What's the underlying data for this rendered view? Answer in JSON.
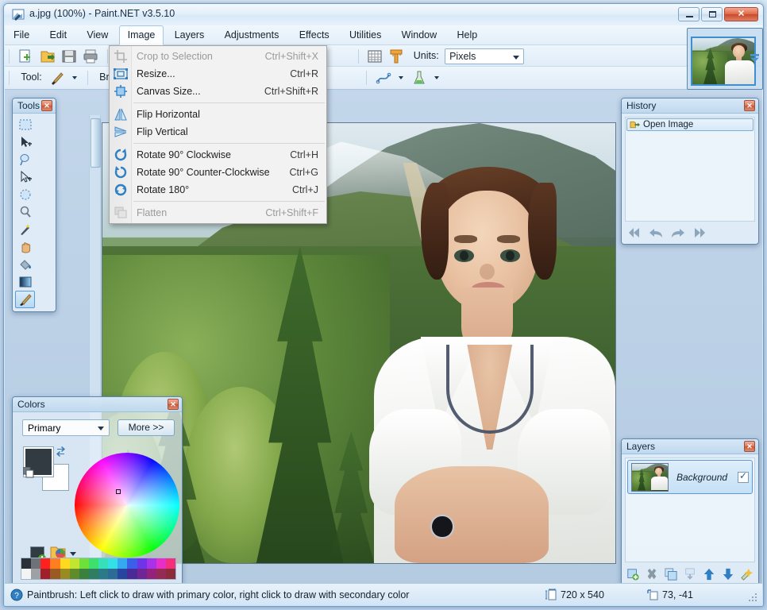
{
  "window": {
    "title": "a.jpg (100%) - Paint.NET v3.5.10",
    "icon": "paintnet-icon",
    "minimize_label": "–",
    "maximize_label": "□",
    "close_label": "✕"
  },
  "menubar": {
    "items": [
      {
        "label": "File",
        "active": false
      },
      {
        "label": "Edit",
        "active": false
      },
      {
        "label": "View",
        "active": false
      },
      {
        "label": "Image",
        "active": true
      },
      {
        "label": "Layers",
        "active": false
      },
      {
        "label": "Adjustments",
        "active": false
      },
      {
        "label": "Effects",
        "active": false
      },
      {
        "label": "Utilities",
        "active": false
      },
      {
        "label": "Window",
        "active": false
      },
      {
        "label": "Help",
        "active": false
      }
    ]
  },
  "image_menu": {
    "items": [
      {
        "label": "Crop to Selection",
        "accel": "Ctrl+Shift+X",
        "disabled": true,
        "icon": "crop-icon"
      },
      {
        "label": "Resize...",
        "accel": "Ctrl+R",
        "disabled": false,
        "icon": "resize-icon"
      },
      {
        "label": "Canvas Size...",
        "accel": "Ctrl+Shift+R",
        "disabled": false,
        "icon": "canvas-size-icon"
      },
      {
        "separator": true
      },
      {
        "label": "Flip Horizontal",
        "accel": "",
        "disabled": false,
        "icon": "flip-horizontal-icon"
      },
      {
        "label": "Flip Vertical",
        "accel": "",
        "disabled": false,
        "icon": "flip-vertical-icon"
      },
      {
        "separator": true
      },
      {
        "label": "Rotate 90° Clockwise",
        "accel": "Ctrl+H",
        "disabled": false,
        "icon": "rotate-cw-icon"
      },
      {
        "label": "Rotate 90° Counter-Clockwise",
        "accel": "Ctrl+G",
        "disabled": false,
        "icon": "rotate-ccw-icon"
      },
      {
        "label": "Rotate 180°",
        "accel": "Ctrl+J",
        "disabled": false,
        "icon": "rotate-180-icon"
      },
      {
        "separator": true
      },
      {
        "label": "Flatten",
        "accel": "Ctrl+Shift+F",
        "disabled": true,
        "icon": "flatten-icon"
      }
    ]
  },
  "toolbar": {
    "buttons": [
      "new-icon",
      "open-icon",
      "save-icon",
      "print-icon",
      "cut-icon"
    ],
    "grid_icon": "grid-icon",
    "ruler_icon": "ruler-icon",
    "units_label": "Units:",
    "units_value": "Pixels",
    "tool_label": "Tool:",
    "tool_icon": "paintbrush-icon",
    "brush_label": "Brush",
    "curve_icon": "curve-icon",
    "antialias_icon": "antialiasing-icon"
  },
  "tools_panel": {
    "title": "Tools",
    "close_label": "✕",
    "tools": [
      {
        "name": "rectangle-select-tool"
      },
      {
        "name": "move-selected-tool"
      },
      {
        "name": "lasso-select-tool"
      },
      {
        "name": "move-selection-tool"
      },
      {
        "name": "ellipse-select-tool"
      },
      {
        "name": "zoom-tool"
      },
      {
        "name": "magic-wand-tool"
      },
      {
        "name": "pan-tool"
      },
      {
        "name": "paint-bucket-tool"
      },
      {
        "name": "gradient-tool"
      },
      {
        "name": "paintbrush-tool",
        "selected": true
      },
      {
        "name": "eraser-tool"
      },
      {
        "name": "pencil-tool"
      },
      {
        "name": "color-picker-tool"
      },
      {
        "name": "clone-stamp-tool"
      },
      {
        "name": "recolor-tool"
      },
      {
        "name": "text-tool"
      },
      {
        "name": "line-curve-tool"
      },
      {
        "name": "rectangle-tool"
      },
      {
        "name": "rounded-rectangle-tool"
      },
      {
        "name": "ellipse-tool"
      },
      {
        "name": "freeform-shape-tool"
      }
    ]
  },
  "history_panel": {
    "title": "History",
    "close_label": "✕",
    "items": [
      {
        "label": "Open Image",
        "icon": "open-image-icon",
        "selected": true
      }
    ],
    "buttons": [
      "rewind-icon",
      "undo-icon",
      "redo-icon",
      "fast-forward-icon"
    ]
  },
  "colors_panel": {
    "title": "Colors",
    "close_label": "✕",
    "selector_value": "Primary",
    "more_label": "More >>",
    "primary_color": "#333b42",
    "secondary_color": "#ffffff",
    "swap_icon": "swap-colors-icon",
    "reset_icon": "reset-colors-icon",
    "add_palette_icon": "add-to-palette-icon",
    "open_palette_icon": "open-palette-icon",
    "palette_row1": [
      "#2b3036",
      "#6e7278",
      "#ff2020",
      "#ff7f20",
      "#ffd91f",
      "#c3e532",
      "#6fe03a",
      "#3ce06b",
      "#36e0bb",
      "#35dfe8",
      "#34a9ef",
      "#3b5fe8",
      "#6f34e8",
      "#a832e8",
      "#e62fc9",
      "#f5307a"
    ],
    "palette_row2": [
      "#f4f4f4",
      "#9da0a4",
      "#a11f2a",
      "#9a5b22",
      "#9a8a22",
      "#5f8b2a",
      "#39813c",
      "#2f7d63",
      "#2a7a87",
      "#2c6b96",
      "#27449e",
      "#4a2a96",
      "#6f2593",
      "#93227c",
      "#952a55",
      "#8e2b3b"
    ]
  },
  "layers_panel": {
    "title": "Layers",
    "close_label": "✕",
    "layers": [
      {
        "name": "Background",
        "visible": true,
        "selected": true
      }
    ],
    "buttons": [
      "add-layer-icon",
      "delete-layer-icon",
      "duplicate-layer-icon",
      "merge-layer-down-icon",
      "move-layer-up-icon",
      "move-layer-down-icon",
      "layer-properties-icon"
    ]
  },
  "image_strip": {
    "thumbnail_name": "a.jpg",
    "dropdown_icon": "chevron-down-icon"
  },
  "statusbar": {
    "help_icon": "help-icon",
    "help_text": "Paintbrush: Left click to draw with primary color, right click to draw with secondary color",
    "size_icon": "image-size-icon",
    "size_text": "720 x 540",
    "cursor_icon": "cursor-position-icon",
    "cursor_text": "73, -41",
    "grip_icon": "resize-grip-icon"
  },
  "canvas": {
    "zoom": "100%",
    "document_name": "a.jpg"
  }
}
